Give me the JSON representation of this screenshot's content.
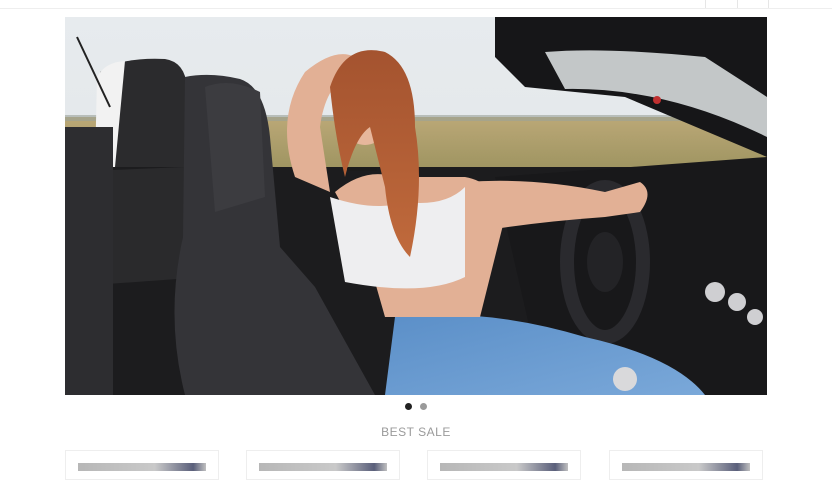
{
  "carousel": {
    "slide_image": "woman-in-convertible-car-photo",
    "dots": [
      {
        "active": true
      },
      {
        "active": false
      }
    ]
  },
  "best_sale": {
    "title": "BEST SALE",
    "products": [
      {
        "image": "product-thumbnail"
      },
      {
        "image": "product-thumbnail"
      },
      {
        "image": "product-thumbnail"
      },
      {
        "image": "product-thumbnail"
      }
    ]
  },
  "colors": {
    "background": "#ffffff",
    "active_dot": "#222222",
    "inactive_dot": "#9a9a9a",
    "section_title": "#9a9a9a"
  }
}
